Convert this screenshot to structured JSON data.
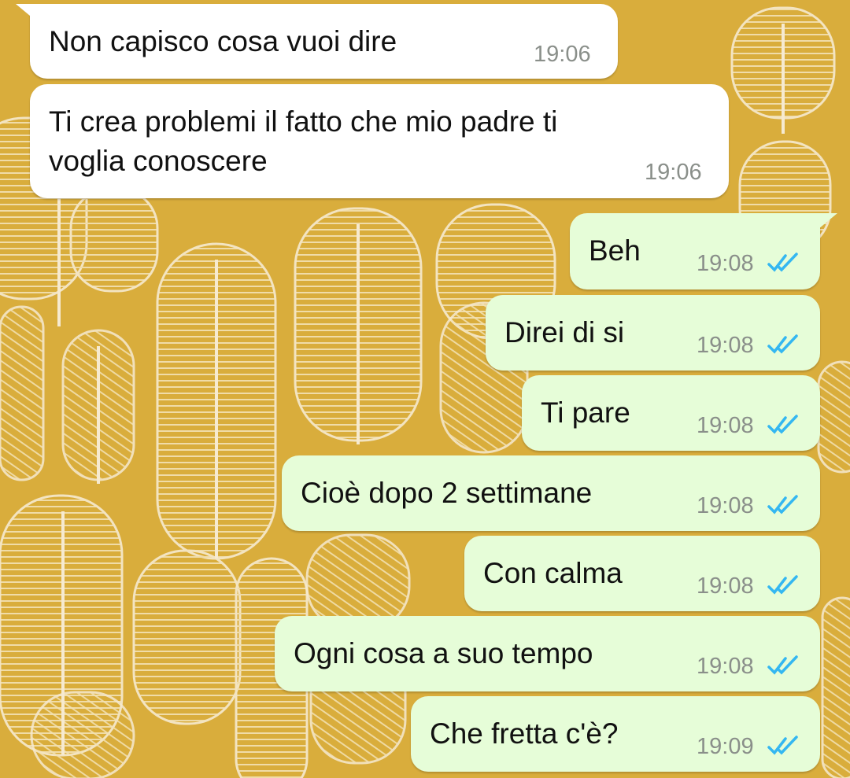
{
  "colors": {
    "wallpaper": "#d9ad3c",
    "incoming_bubble": "#ffffff",
    "outgoing_bubble": "#e6fdd8",
    "read_ticks": "#34b7f1",
    "timestamp": "#8a8f8a"
  },
  "messages": [
    {
      "direction": "in",
      "text": [
        "Non capisco cosa vuoi dire"
      ],
      "time": "19:06"
    },
    {
      "direction": "in",
      "text": [
        "Ti crea problemi il fatto che mio padre ti",
        "voglia conoscere"
      ],
      "time": "19:06"
    },
    {
      "direction": "out",
      "text": [
        "Beh"
      ],
      "time": "19:08",
      "status_icon": "double-check-read-icon"
    },
    {
      "direction": "out",
      "text": [
        "Direi di si"
      ],
      "time": "19:08",
      "status_icon": "double-check-read-icon"
    },
    {
      "direction": "out",
      "text": [
        "Ti pare"
      ],
      "time": "19:08",
      "status_icon": "double-check-read-icon"
    },
    {
      "direction": "out",
      "text": [
        "Cioè dopo 2 settimane"
      ],
      "time": "19:08",
      "status_icon": "double-check-read-icon"
    },
    {
      "direction": "out",
      "text": [
        "Con calma"
      ],
      "time": "19:08",
      "status_icon": "double-check-read-icon"
    },
    {
      "direction": "out",
      "text": [
        "Ogni cosa a suo tempo"
      ],
      "time": "19:08",
      "status_icon": "double-check-read-icon"
    },
    {
      "direction": "out",
      "text": [
        "Che fretta c'è?"
      ],
      "time": "19:09",
      "status_icon": "double-check-read-icon"
    }
  ]
}
